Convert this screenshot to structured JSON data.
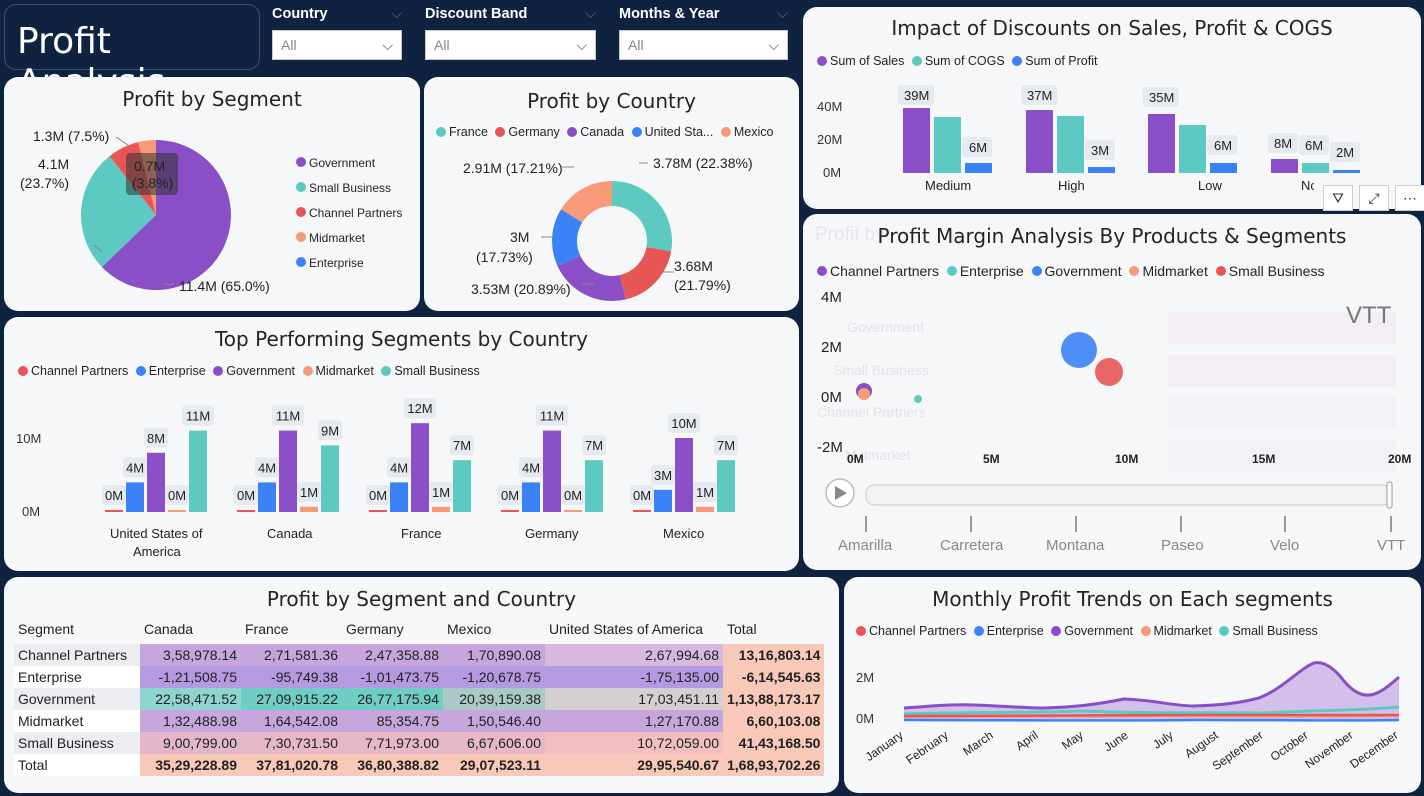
{
  "header": {
    "title": "Profit Analysis"
  },
  "slicers": [
    {
      "label": "Country",
      "value": "All"
    },
    {
      "label": "Discount Band",
      "value": "All"
    },
    {
      "label": "Months & Year",
      "value": "All"
    }
  ],
  "colors": {
    "government": "#8a4fc7",
    "small_business": "#5cc9c2",
    "channel_partners": "#e85555",
    "midmarket": "#f79a7a",
    "enterprise": "#3b82f6",
    "navy": "#0f2340"
  },
  "segment_pie": {
    "title": "Profit by Segment",
    "legend": [
      "Government",
      "Small Business",
      "Channel Partners",
      "Midmarket",
      "Enterprise"
    ],
    "labels": {
      "gov": "11.4M (65.0%)",
      "sb_a": "4.1M",
      "sb_b": "(23.7%)",
      "cp": "1.3M (7.5%)",
      "tip_a": "0.7M",
      "tip_b": "(3.8%)"
    }
  },
  "country_donut": {
    "title": "Profit by Country",
    "legend": [
      "France",
      "Germany",
      "Canada",
      "United Sta...",
      "Mexico"
    ],
    "labels": {
      "france": "3.78M (22.38%)",
      "germany_a": "3.68M",
      "germany_b": "(21.79%)",
      "canada": "3.53M (20.89%)",
      "usa_a": "3M",
      "usa_b": "(17.73%)",
      "mexico": "2.91M (17.21%)"
    }
  },
  "discount_chart": {
    "title": "Impact of Discounts on Sales, Profit & COGS",
    "legend": [
      "Sum of  Sales",
      "Sum of COGS",
      "Sum of Profit"
    ],
    "y_ticks": [
      "40M",
      "20M",
      "0M"
    ],
    "categories": [
      "Medium",
      "High",
      "Low",
      "Nor"
    ],
    "labels": [
      [
        "39M",
        "6M"
      ],
      [
        "37M",
        "3M"
      ],
      [
        "35M",
        "6M"
      ],
      [
        "8M",
        "6M",
        "2M"
      ]
    ]
  },
  "margin_chart": {
    "title": "Profit Margin Analysis By Products & Segments",
    "legend": [
      "Channel Partners",
      "Enterprise",
      "Government",
      "Midmarket",
      "Small Business"
    ],
    "y_ticks": [
      "4M",
      "2M",
      "0M",
      "-2M"
    ],
    "x_ticks": [
      "0M",
      "5M",
      "10M",
      "15M",
      "20M"
    ],
    "watermark": "VTT",
    "products": [
      "Amarilla",
      "Carretera",
      "Montana",
      "Paseo",
      "Velo",
      "VTT"
    ],
    "ghost_title": "Profit by",
    "ghost_rows": [
      "Government",
      "Small Business",
      "Channel Partners",
      "Midmarket"
    ]
  },
  "segments_country": {
    "title": "Top Performing Segments by Country",
    "legend": [
      "Channel Partners",
      "Enterprise",
      "Government",
      "Midmarket",
      "Small Business"
    ],
    "y_ticks": [
      "10M",
      "0M"
    ],
    "countries": [
      "United States of",
      "America",
      "Canada",
      "France",
      "Germany",
      "Mexico"
    ],
    "labels": [
      [
        "0M",
        "4M",
        "8M",
        "0M",
        "11M"
      ],
      [
        "0M",
        "4M",
        "11M",
        "1M",
        "9M"
      ],
      [
        "0M",
        "4M",
        "12M",
        "1M",
        "7M"
      ],
      [
        "0M",
        "4M",
        "11M",
        "0M",
        "7M"
      ],
      [
        "0M",
        "3M",
        "10M",
        "1M",
        "7M"
      ]
    ]
  },
  "matrix": {
    "title": "Profit by Segment and Country",
    "columns": [
      "Segment",
      "Canada",
      "France",
      "Germany",
      "Mexico",
      "United States of America",
      "Total"
    ],
    "rows": [
      [
        "Channel Partners",
        "3,58,978.14",
        "2,71,581.36",
        "2,47,358.88",
        "1,70,890.08",
        "2,67,994.68",
        "13,16,803.14"
      ],
      [
        "Enterprise",
        "-1,21,508.75",
        "-95,749.38",
        "-1,01,473.75",
        "-1,20,678.75",
        "-1,75,135.00",
        "-6,14,545.63"
      ],
      [
        "Government",
        "22,58,471.52",
        "27,09,915.22",
        "26,77,175.94",
        "20,39,159.38",
        "17,03,451.11",
        "1,13,88,173.17"
      ],
      [
        "Midmarket",
        "1,32,488.98",
        "1,64,542.08",
        "85,354.75",
        "1,50,546.40",
        "1,27,170.88",
        "6,60,103.08"
      ],
      [
        "Small Business",
        "9,00,799.00",
        "7,30,731.50",
        "7,71,973.00",
        "6,67,606.00",
        "10,72,059.00",
        "41,43,168.50"
      ],
      [
        "Total",
        "35,29,228.89",
        "37,81,020.78",
        "36,80,388.82",
        "29,07,523.11",
        "29,95,540.67",
        "1,68,93,702.26"
      ]
    ]
  },
  "monthly": {
    "title": "Monthly Profit Trends on Each segments",
    "legend": [
      "Channel Partners",
      "Enterprise",
      "Government",
      "Midmarket",
      "Small Business"
    ],
    "y_ticks": [
      "2M",
      "0M"
    ],
    "months": [
      "January",
      "February",
      "March",
      "April",
      "May",
      "June",
      "July",
      "August",
      "September",
      "October",
      "November",
      "December"
    ]
  }
}
